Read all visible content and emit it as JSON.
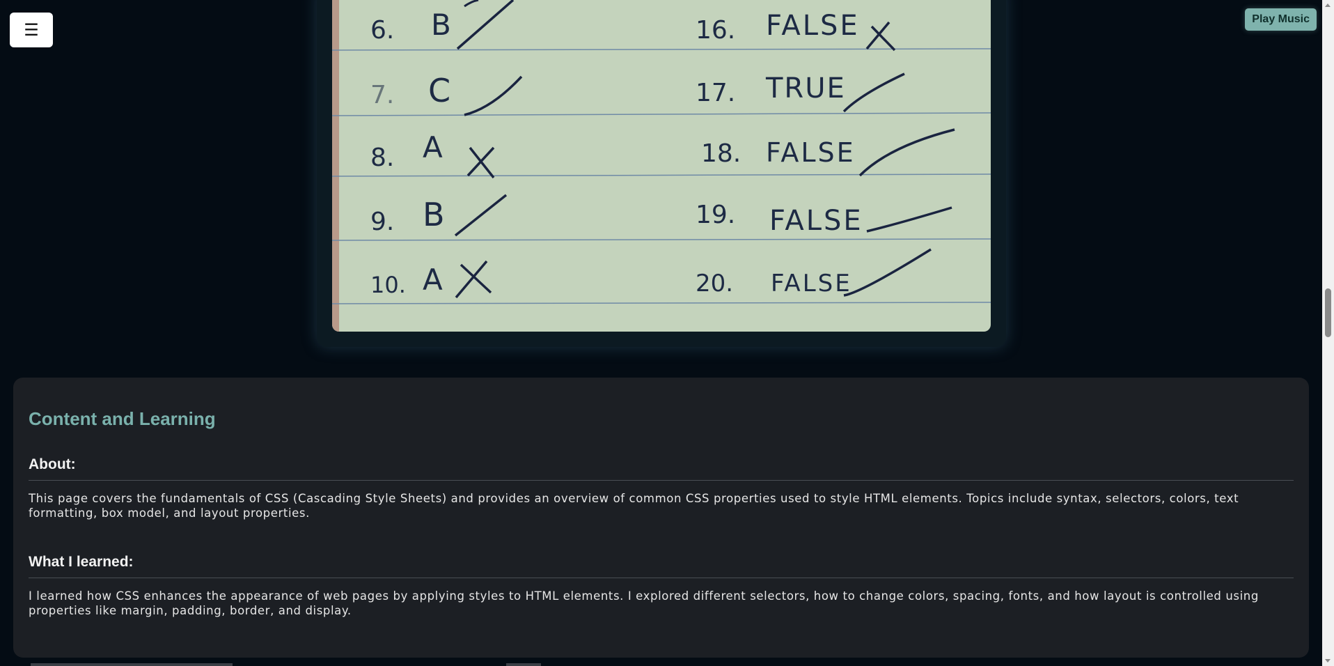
{
  "header": {
    "menu_icon": "☰",
    "play_music_label": "Play Music"
  },
  "answer_sheet": {
    "left_column": [
      {
        "number": "6.",
        "answer": "B",
        "mark": "check"
      },
      {
        "number": "7.",
        "answer": "C",
        "mark": "check"
      },
      {
        "number": "8.",
        "answer": "A",
        "mark": "cross"
      },
      {
        "number": "9.",
        "answer": "B",
        "mark": "check"
      },
      {
        "number": "10.",
        "answer": "A",
        "mark": "cross"
      }
    ],
    "right_column": [
      {
        "number": "16.",
        "answer": "FALSE",
        "mark": "cross"
      },
      {
        "number": "17.",
        "answer": "TRUE",
        "mark": "check"
      },
      {
        "number": "18.",
        "answer": "FALSE",
        "mark": "check"
      },
      {
        "number": "19.",
        "answer": "FALSE",
        "mark": "check"
      },
      {
        "number": "20.",
        "answer": "FALSE",
        "mark": "check"
      }
    ]
  },
  "content": {
    "title": "Content and Learning",
    "about": {
      "heading": "About:",
      "text": "This page covers the fundamentals of CSS (Cascading Style Sheets) and provides an overview of common CSS properties used to style HTML elements. Topics include syntax, selectors, colors, text formatting, box model, and layout properties."
    },
    "learned": {
      "heading": "What I learned:",
      "text": "I learned how CSS enhances the appearance of web pages by applying styles to HTML elements. I explored different selectors, how to change colors, spacing, fonts, and how layout is controlled using properties like margin, padding, border, and display."
    }
  },
  "colors": {
    "background": "#040c14",
    "accent": "#7ab1ac",
    "card": "#1c1f24",
    "paper": "#c4d3bc"
  }
}
